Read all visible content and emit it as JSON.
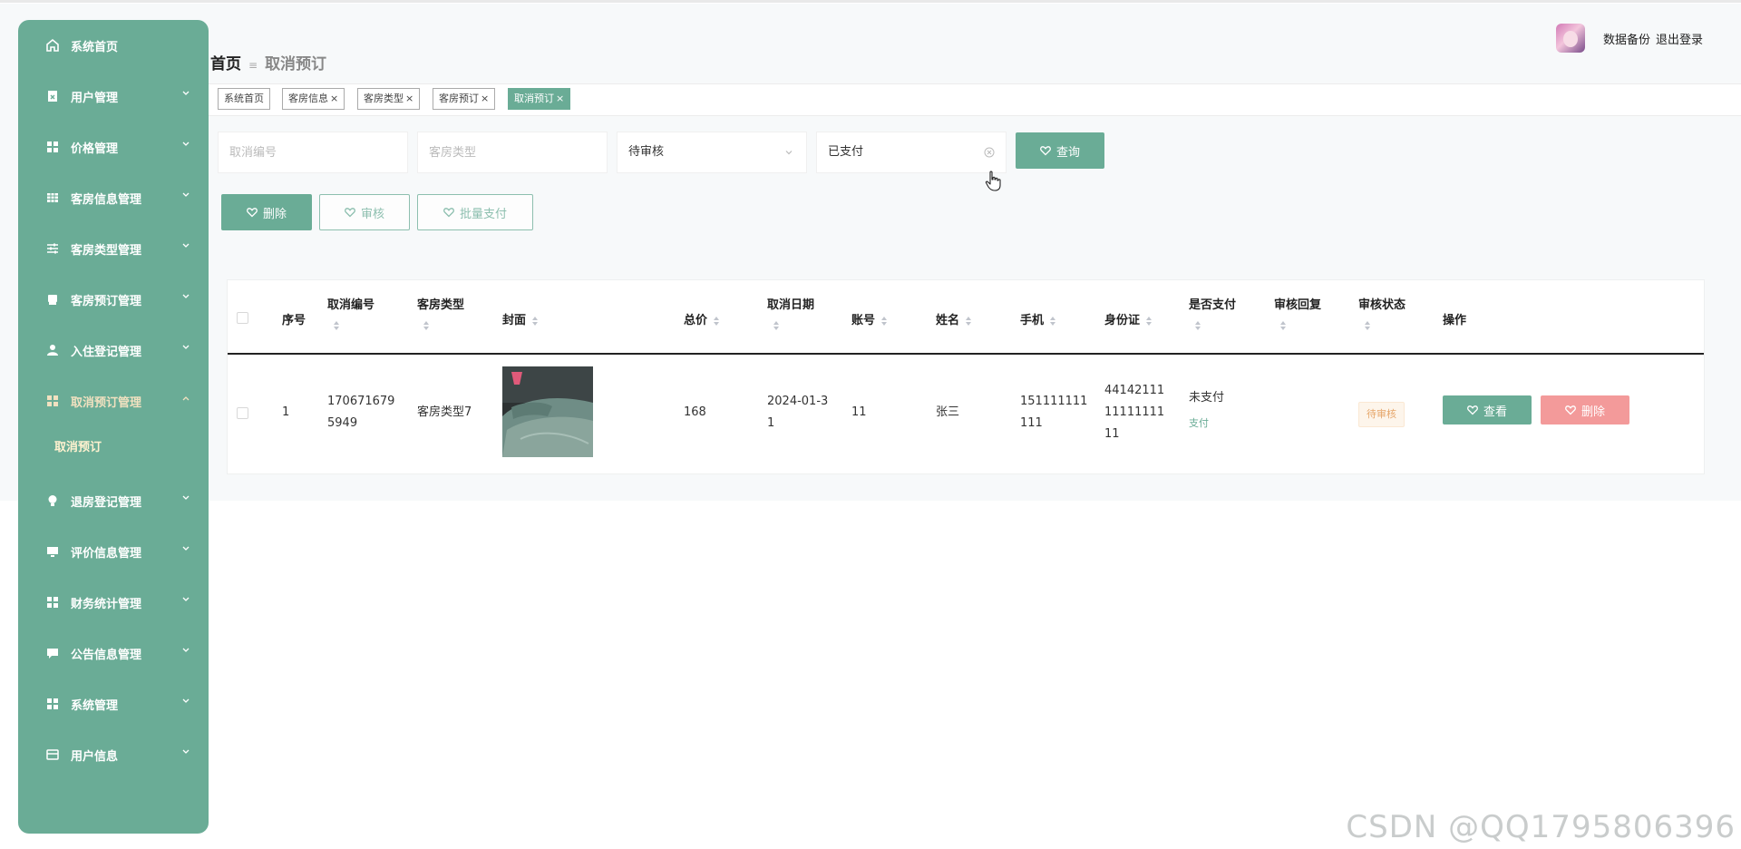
{
  "sidebar": {
    "items": [
      {
        "label": "系统首页",
        "icon": "home-icon"
      },
      {
        "label": "用户管理",
        "icon": "user-manage-icon"
      },
      {
        "label": "价格管理",
        "icon": "grid-icon"
      },
      {
        "label": "客房信息管理",
        "icon": "table-icon"
      },
      {
        "label": "客房类型管理",
        "icon": "sliders-icon"
      },
      {
        "label": "客房预订管理",
        "icon": "printer-icon"
      },
      {
        "label": "入住登记管理",
        "icon": "person-icon"
      },
      {
        "label": "取消预订管理",
        "icon": "grid-icon"
      },
      {
        "label": "退房登记管理",
        "icon": "bulb-icon"
      },
      {
        "label": "评价信息管理",
        "icon": "monitor-icon"
      },
      {
        "label": "财务统计管理",
        "icon": "grid-icon"
      },
      {
        "label": "公告信息管理",
        "icon": "chat-icon"
      },
      {
        "label": "系统管理",
        "icon": "grid-icon"
      },
      {
        "label": "用户信息",
        "icon": "card-icon"
      }
    ],
    "sub_item": "取消预订"
  },
  "header": {
    "breadcrumb_home": "首页",
    "breadcrumb_sep": "≡",
    "breadcrumb_current": "取消预订",
    "backup": "数据备份",
    "logout": "退出登录"
  },
  "tags": [
    "系统首页",
    "客房信息",
    "客房类型",
    "客房预订",
    "取消预订"
  ],
  "tag_close": "×",
  "filters": {
    "cancel_no_placeholder": "取消编号",
    "room_type_placeholder": "客房类型",
    "audit_status_value": "待审核",
    "pay_status_value": "已支付",
    "query_label": "查询"
  },
  "actions": {
    "delete": "删除",
    "audit": "审核",
    "batch_pay": "批量支付"
  },
  "table": {
    "headers": {
      "index": "序号",
      "cancel_no": "取消编号",
      "room_type": "客房类型",
      "cover": "封面",
      "total": "总价",
      "cancel_date": "取消日期",
      "account": "账号",
      "name": "姓名",
      "phone": "手机",
      "id_card": "身份证",
      "paid": "是否支付",
      "audit_reply": "审核回复",
      "audit_status": "审核状态",
      "operation": "操作"
    },
    "row": {
      "index": "1",
      "cancel_no_1": "170671679",
      "cancel_no_2": "5949",
      "room_type": "客房类型7",
      "total": "168",
      "date_1": "2024-01-3",
      "date_2": "1",
      "account": "11",
      "name": "张三",
      "phone_1": "151111111",
      "phone_2": "111",
      "id_1": "44142111",
      "id_2": "11111111",
      "id_3": "11",
      "paid": "未支付",
      "pay_link": "支付",
      "audit_status": "待审核",
      "view": "查看",
      "delete": "删除"
    }
  },
  "watermark": "CSDN @QQ1795806396",
  "colors": {
    "accent": "#6aac96",
    "danger": "#f39a9a",
    "warning": "#e6a66a"
  }
}
